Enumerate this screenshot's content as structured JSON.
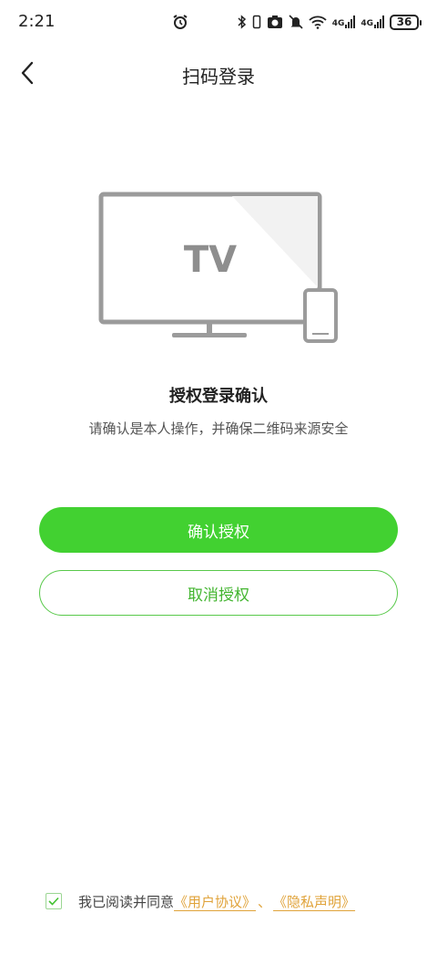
{
  "status_bar": {
    "time": "2:21",
    "battery": "36",
    "network_1": "4G",
    "network_2": "4G",
    "wifi_label": "6"
  },
  "header": {
    "title": "扫码登录"
  },
  "illustration": {
    "screen_text": "TV"
  },
  "main": {
    "title": "授权登录确认",
    "description": "请确认是本人操作，并确保二维码来源安全",
    "confirm_label": "确认授权",
    "cancel_label": "取消授权"
  },
  "agreement": {
    "checked": true,
    "prefix": "我已阅读并同意",
    "user_agreement": "《用户协议》",
    "separator": "、",
    "privacy": "《隐私声明》"
  },
  "colors": {
    "primary": "#42d131",
    "link": "#e0a33a"
  }
}
